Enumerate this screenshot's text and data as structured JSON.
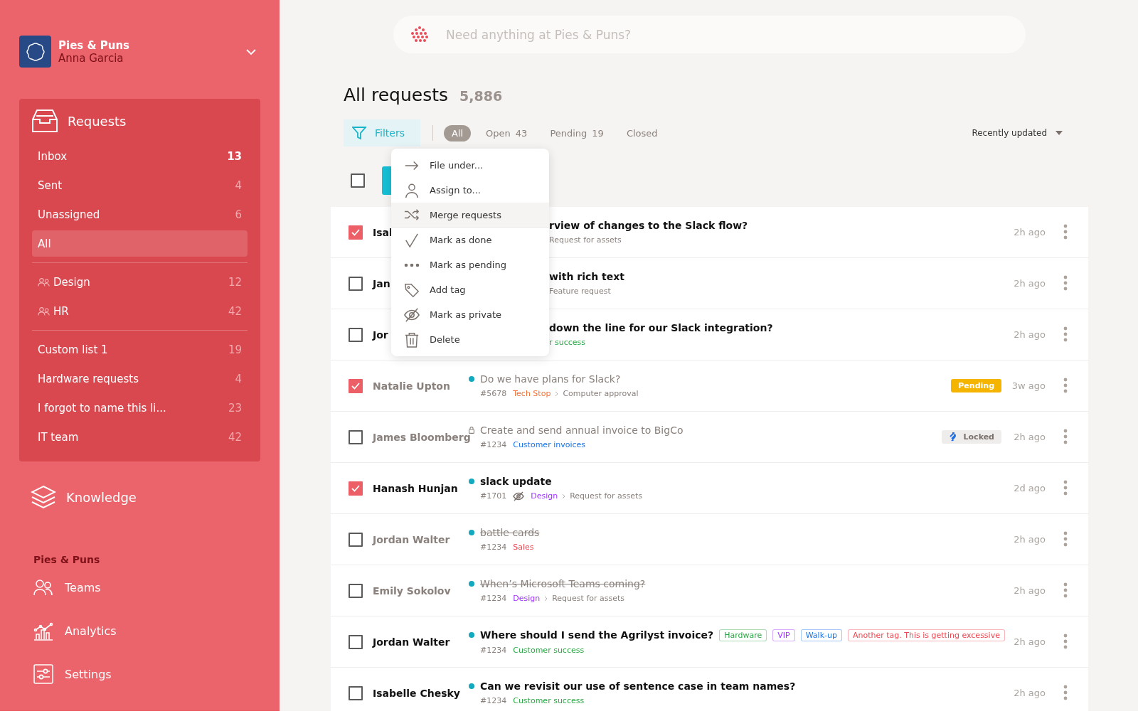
{
  "workspace": {
    "name": "Pies & Puns",
    "user": "Anna Garcia"
  },
  "requests_nav": {
    "title": "Requests",
    "groups": [
      [
        {
          "label": "Inbox",
          "count": "13",
          "selected": false,
          "unread": true,
          "kind": "list"
        },
        {
          "label": "Sent",
          "count": "4",
          "selected": false,
          "unread": false,
          "kind": "list"
        },
        {
          "label": "Unassigned",
          "count": "6",
          "selected": false,
          "unread": false,
          "kind": "list"
        },
        {
          "label": "All",
          "selected": true,
          "kind": "list"
        }
      ],
      [
        {
          "label": "Design",
          "count": "12",
          "selected": false,
          "unread": false,
          "kind": "team"
        },
        {
          "label": "HR",
          "count": "42",
          "selected": false,
          "unread": false,
          "kind": "team"
        }
      ],
      [
        {
          "label": "Custom list 1",
          "count": "19",
          "selected": false,
          "unread": false,
          "kind": "list"
        },
        {
          "label": "Hardware requests",
          "count": "4",
          "selected": false,
          "unread": false,
          "kind": "list"
        },
        {
          "label": "I forgot to name this li...",
          "count": "23",
          "selected": false,
          "unread": false,
          "kind": "list"
        },
        {
          "label": "IT team",
          "count": "42",
          "selected": false,
          "unread": false,
          "kind": "list"
        }
      ]
    ]
  },
  "knowledge": {
    "label": "Knowledge"
  },
  "org_section": {
    "title": "Pies & Puns",
    "items": [
      {
        "label": "Teams",
        "kind": "teams"
      },
      {
        "label": "Analytics",
        "kind": "analytics"
      },
      {
        "label": "Settings",
        "kind": "settings"
      }
    ]
  },
  "search": {
    "placeholder": "Need anything at Pies & Puns?"
  },
  "page": {
    "title": "All requests",
    "count": "5,886"
  },
  "filters_button": "Filters",
  "status_tabs": [
    {
      "label": "All",
      "selected": true
    },
    {
      "label": "Open",
      "count": "43",
      "selected": false
    },
    {
      "label": "Pending",
      "count": "19",
      "selected": false
    },
    {
      "label": "Closed",
      "selected": false
    }
  ],
  "sort": "Recently updated",
  "select_all": {
    "checked": false
  },
  "context_menu": [
    {
      "label": "File under...",
      "kind": "arrow",
      "selected": false
    },
    {
      "label": "Assign to...",
      "kind": "person",
      "selected": false
    },
    {
      "label": "Merge requests",
      "kind": "shuffle",
      "selected": true
    },
    {
      "label": "Mark as done",
      "kind": "check",
      "selected": false
    },
    {
      "label": "Mark as pending",
      "kind": "dots",
      "selected": false
    },
    {
      "label": "Add tag",
      "kind": "tag",
      "selected": false
    },
    {
      "label": "Mark as private",
      "kind": "private",
      "selected": false
    },
    {
      "label": "Delete",
      "kind": "trash",
      "selected": false
    }
  ],
  "rows": [
    {
      "kind": "covered",
      "checked": true,
      "unread": true,
      "done": false,
      "private": false,
      "requester": "Isal",
      "subject": "rview of changes to the Slack flow?",
      "subcategory": "Request for assets",
      "time": "2h ago"
    },
    {
      "kind": "covered",
      "checked": false,
      "unread": true,
      "done": false,
      "private": false,
      "requester": "Jan",
      "subject": "with rich text",
      "subcategory": "Feature request",
      "time": "2h ago"
    },
    {
      "kind": "covered",
      "checked": false,
      "unread": true,
      "done": false,
      "private": false,
      "requester": "Jor",
      "subject": "down the line for our Slack integration?",
      "category": {
        "text": "r success",
        "color": "#2aa845"
      },
      "time": "2h ago"
    },
    {
      "kind": "full",
      "locked": false,
      "checked": true,
      "unread": false,
      "done": false,
      "private": false,
      "requester": "Natalie Upton",
      "subject": "Do we have plans for Slack?",
      "number": "#5678",
      "category": {
        "text": "Tech Stop",
        "color": "#f2733a"
      },
      "subcategory": "Computer approval",
      "badge": {
        "text": "Pending",
        "kind": "pending"
      },
      "time": "3w ago"
    },
    {
      "kind": "full",
      "locked": true,
      "checked": false,
      "unread": false,
      "done": false,
      "private": false,
      "requester": "James Bloomberg",
      "subject": "Create and send annual invoice to BigCo",
      "number": "#1234",
      "category": {
        "text": "Customer invoices",
        "color": "#1a73e8"
      },
      "badge": {
        "text": "Locked",
        "kind": "locked"
      },
      "time": "2h ago"
    },
    {
      "kind": "full",
      "locked": false,
      "checked": true,
      "unread": true,
      "done": false,
      "private": true,
      "requester": "Hanash Hunjan",
      "subject": "slack update",
      "number": "#1701",
      "category": {
        "text": "Design",
        "color": "#9b30ff"
      },
      "subcategory": "Request for assets",
      "time": "2d ago"
    },
    {
      "kind": "full",
      "locked": false,
      "checked": false,
      "unread": false,
      "done": true,
      "private": false,
      "requester": "Jordan Walter",
      "subject": "battle cards",
      "number": "#1234",
      "category": {
        "text": "Sales",
        "color": "#f0454f"
      },
      "time": "2h ago"
    },
    {
      "kind": "full",
      "locked": false,
      "checked": false,
      "unread": false,
      "done": true,
      "private": false,
      "requester": "Emily Sokolov",
      "subject": "When’s Microsoft Teams coming?",
      "number": "#1234",
      "category": {
        "text": "Design",
        "color": "#9b30ff"
      },
      "subcategory": "Request for assets",
      "time": "2h ago"
    },
    {
      "kind": "full",
      "locked": false,
      "checked": false,
      "unread": true,
      "done": false,
      "private": false,
      "requester": "Jordan Walter",
      "subject": "Where should I send the Agrilyst invoice?",
      "tags": [
        {
          "text": "Hardware",
          "color": "#2aa845"
        },
        {
          "text": "VIP",
          "color": "#9b30ff"
        },
        {
          "text": "Walk-up",
          "color": "#1a73e8"
        },
        {
          "text": "Another tag. This is getting excessive",
          "color": "#f0454f"
        }
      ],
      "number": "#1234",
      "category": {
        "text": "Customer success",
        "color": "#2aa845"
      },
      "time": "2h ago"
    },
    {
      "kind": "full",
      "locked": false,
      "checked": false,
      "unread": true,
      "done": false,
      "private": false,
      "requester": "Isabelle Chesky",
      "subject": "Can we revisit our use of sentence case in team names?",
      "number": "#1234",
      "category": {
        "text": "Customer success",
        "color": "#2aa845"
      },
      "time": "2h ago"
    }
  ]
}
